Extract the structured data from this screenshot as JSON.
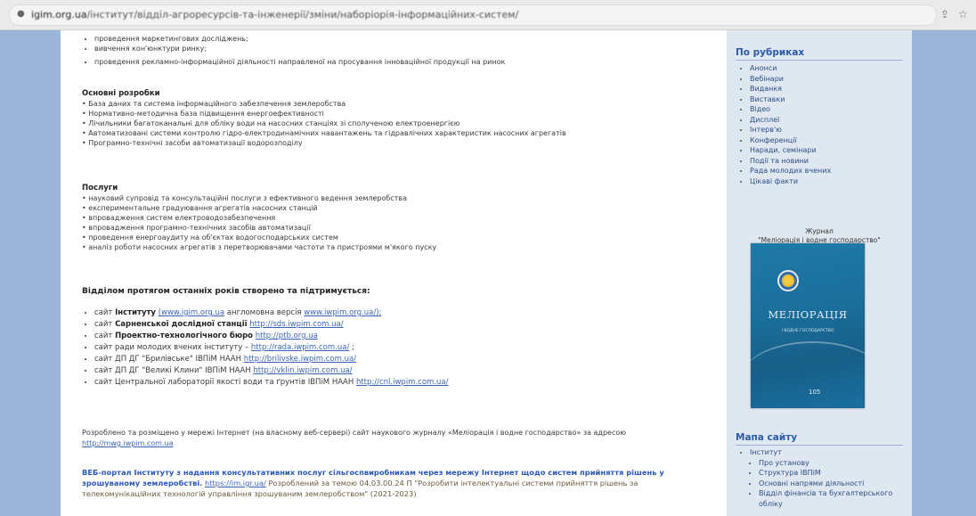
{
  "browser": {
    "url_host": "igim.org.ua",
    "url_path": "/інститут/відділ-агроресурсів-та-інженерії/зміни/наборіорія-інформаційних-систем/"
  },
  "content": {
    "top_list": [
      "проведення маркетингових досліджень;",
      "вивчення кон'юнктури ринку;",
      "проведення рекламно-інформаційної діяльності направленої на просування інноваційної продукції на ринок"
    ],
    "main_dev_heading": "Основні розробки",
    "main_dev": [
      "База даних та система інформаційного забезпечення землеробства",
      "Нормативно-методична база підвищення енергоефективності",
      "Лічильники багатоканальні для обліку води на насосних станціях зі сполученою електроенергією",
      "Автоматизовані системи контролю гідро-електродинамічних навантажень та гідравлічних характеристик насосних агрегатів",
      "Програмно-технічні засоби автоматизації водорозподілу"
    ],
    "services_heading": "Послуги",
    "services": [
      "науковий супровід та консультаційні послуги з ефективного ведення землеробства",
      "експериментальне градуювання агрегатів насосних станцій",
      "впровадження систем електроводозабезпечення",
      "впровадження програмно-технічних засобів автоматизації",
      "проведення енергоаудиту на об'єктах водогосподарських систем",
      "аналіз роботи насосних агрегатів з перетворювачами частоти та пристроями м'якого пуску"
    ],
    "sites_heading": "Відділом протягом останніх років створено та підтримується:",
    "sites": [
      {
        "pre": "сайт ",
        "bold": "Інституту",
        "post": " ",
        "link": "(www.igim.org.ua",
        "post2": " англомовна версія ",
        "link2": "www.iwpim.org.ua/);"
      },
      {
        "pre": "сайт ",
        "bold": "Сарненської дослідної станції",
        "post": " ",
        "link": "http://sds.iwpim.com.ua/",
        "post2": "",
        "link2": ""
      },
      {
        "pre": "сайт ",
        "bold": "Проектно-технологічного бюро",
        "post": " ",
        "link": "http://ptb.org.ua",
        "post2": "",
        "link2": ""
      },
      {
        "pre": "сайт ради молодих вчених інституту – ",
        "bold": "",
        "post": "",
        "link": "http://rada.iwpim.com.ua/",
        "post2": " ;",
        "link2": ""
      },
      {
        "pre": "сайт ДП ДГ \"Брилівське\" ІВПіМ НААН ",
        "bold": "",
        "post": "",
        "link": "http://brilivske.iwpim.com.ua/",
        "post2": "",
        "link2": ""
      },
      {
        "pre": "сайт ДП ДГ \"Великі Клини\" ІВПіМ НААН ",
        "bold": "",
        "post": "",
        "link": "http://vklin.iwpim.com.ua/",
        "post2": "",
        "link2": ""
      },
      {
        "pre": "сайт Центральної лабораторії якості води та ґрунтів ІВПіМ НААН ",
        "bold": "",
        "post": "",
        "link": "http://cnl.iwpim.com.ua/",
        "post2": "",
        "link2": ""
      }
    ],
    "journal_par_text": "Розроблено та розміщено у мережі Інтернет (на власному веб-сервері) сайт наукового журналу «Меліорація і водне господарство» за адресою",
    "journal_par_link": "http://mwg.iwpim.com.ua",
    "portal_bold": "ВЕБ-портал Інституту з надання консультативних послуг сільгоспвиробникам через мережу Інтернет щодо систем прийняття рішень у зрошуваному землеробстві.",
    "portal_link": "https://im.igr.ua/",
    "portal_rest": "Розроблений за темою 04.03.00.24 П \"Розробити інтелектуальні системи прийняття рішень за телекомунікаційних технологій управління зрошуваним землеробством\" (2021-2023)"
  },
  "sidebar": {
    "rubrics_title": "По рубриках",
    "rubrics": [
      "Анонси",
      "Вебінари",
      "Виданкя",
      "Виставки",
      "Відео",
      "Дисплеї",
      "Інтерв'ю",
      "Конференції",
      "Наради, семінари",
      "Події та новини",
      "Рада молодих вчених",
      "Цікаві факти"
    ],
    "journal_caption_1": "Журнал",
    "journal_caption_2": "\"Меліорація і водне господарство\"",
    "cover_title": "МЕЛІОРАЦІЯ",
    "cover_subtitle": "І ВОДНЕ ГОСПОДАРСТВО",
    "cover_number": "105",
    "sitemap_title": "Мапа сайту",
    "sitemap_root": "Інститут",
    "sitemap": [
      "Про установу",
      "Структура ІВПіМ",
      "Основні напрями діяльності",
      "Відділ фінансів та бухгалтерського обліку"
    ]
  }
}
